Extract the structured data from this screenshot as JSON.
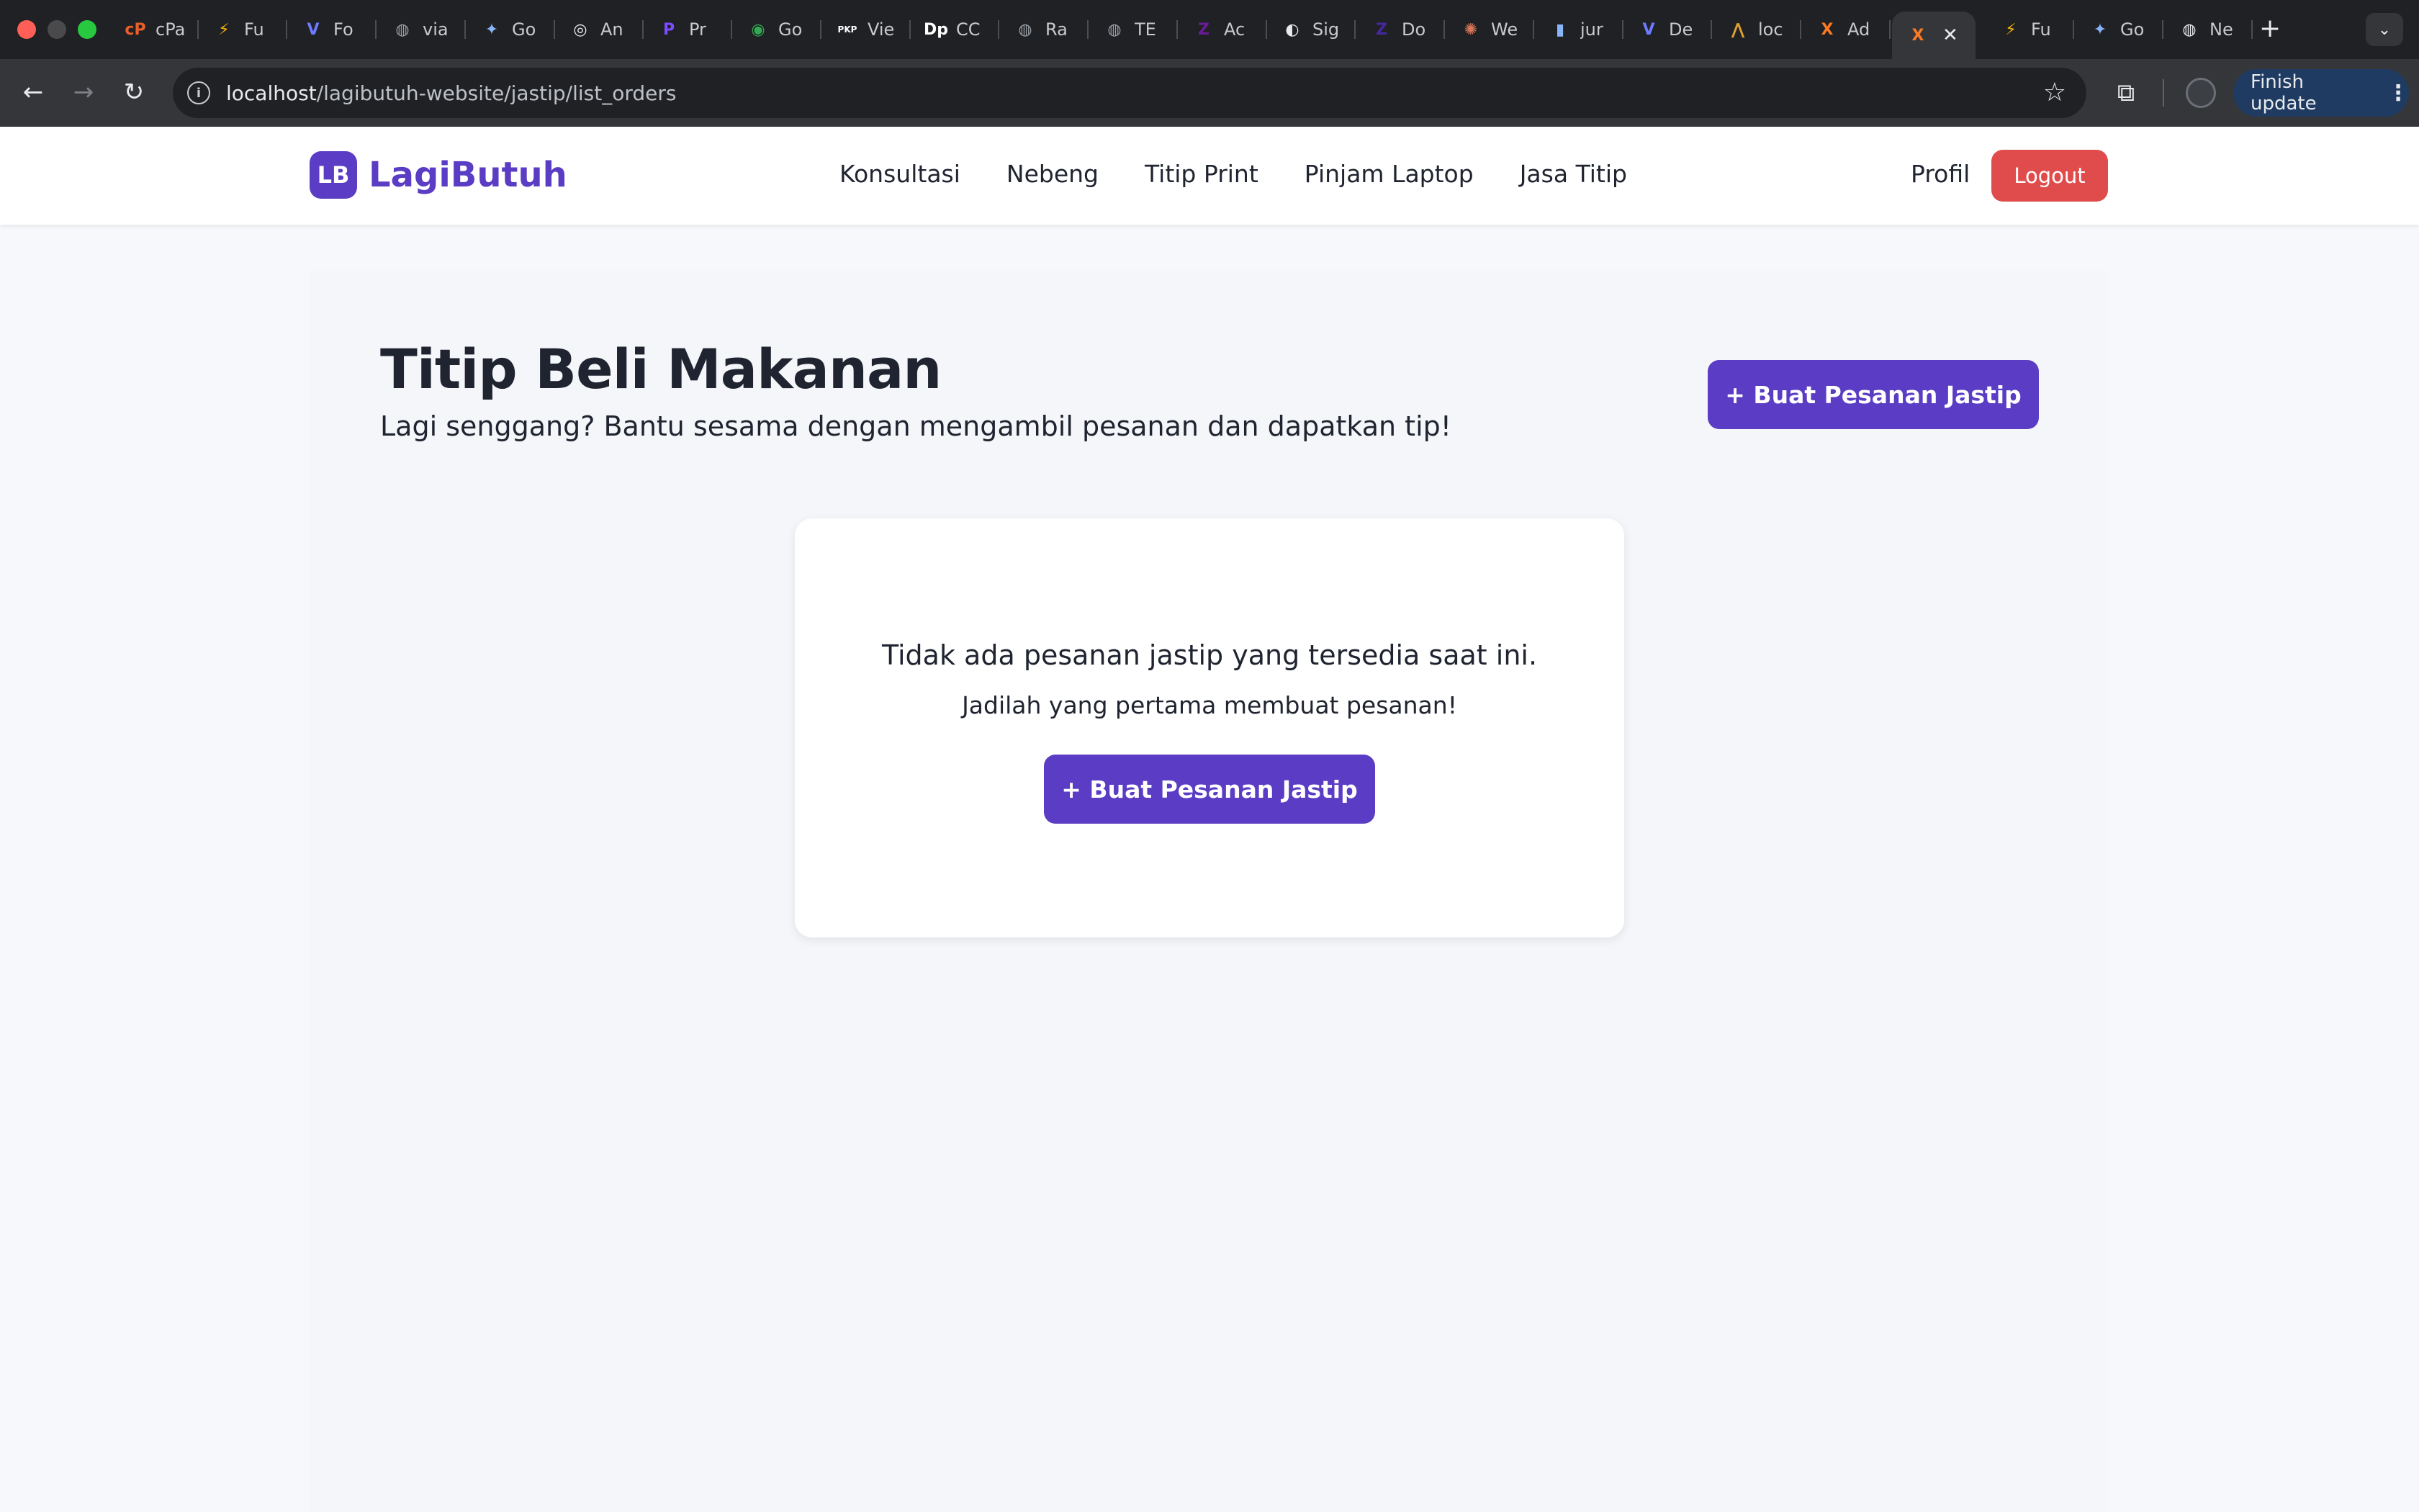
{
  "browser": {
    "tabs": [
      {
        "title": "cPanel",
        "icon": "cpanel-icon",
        "color": "#e8602c",
        "glyph": "cP"
      },
      {
        "title": "Fu",
        "icon": "bolt-icon",
        "color": "#f4b400",
        "glyph": "⚡"
      },
      {
        "title": "Fo",
        "icon": "vercel-icon",
        "color": "#6c7bff",
        "glyph": "V"
      },
      {
        "title": "via",
        "icon": "globe-icon",
        "color": "#9aa0a6",
        "glyph": "◍"
      },
      {
        "title": "Go",
        "icon": "gemini-icon",
        "color": "#8ab4f8",
        "glyph": "✦"
      },
      {
        "title": "An",
        "icon": "openai-icon",
        "color": "#e8eaed",
        "glyph": "◎"
      },
      {
        "title": "Pr",
        "icon": "app-icon",
        "color": "#7c4dff",
        "glyph": "P"
      },
      {
        "title": "Go",
        "icon": "maps-icon",
        "color": "#34a853",
        "glyph": "◉"
      },
      {
        "title": "Vie",
        "icon": "pkp-icon",
        "color": "#ffffff",
        "glyph": "PKP"
      },
      {
        "title": "CC",
        "icon": "dp-icon",
        "color": "#ffffff",
        "glyph": "Dp"
      },
      {
        "title": "Ra",
        "icon": "globe-icon",
        "color": "#9aa0a6",
        "glyph": "◍"
      },
      {
        "title": "TE",
        "icon": "globe-icon",
        "color": "#9aa0a6",
        "glyph": "◍"
      },
      {
        "title": "Ac",
        "icon": "app-icon",
        "color": "#6a1b9a",
        "glyph": "Z"
      },
      {
        "title": "Sig",
        "icon": "github-icon",
        "color": "#e8eaed",
        "glyph": "◐"
      },
      {
        "title": "Do",
        "icon": "app-icon",
        "color": "#4527a0",
        "glyph": "Z"
      },
      {
        "title": "We",
        "icon": "claude-icon",
        "color": "#d97757",
        "glyph": "✺"
      },
      {
        "title": "jur",
        "icon": "doc-icon",
        "color": "#8ab4f8",
        "glyph": "▮"
      },
      {
        "title": "De",
        "icon": "vercel-icon",
        "color": "#6c7bff",
        "glyph": "V"
      },
      {
        "title": "loc",
        "icon": "app-icon",
        "color": "#e0a030",
        "glyph": "⋀"
      },
      {
        "title": "Ad",
        "icon": "xampp-icon",
        "color": "#fb7a24",
        "glyph": "X"
      },
      {
        "title": "",
        "icon": "xampp-icon",
        "color": "#fb7a24",
        "glyph": "X",
        "active": true
      },
      {
        "title": "Fu",
        "icon": "bolt-icon",
        "color": "#f4b400",
        "glyph": "⚡"
      },
      {
        "title": "Go",
        "icon": "gemini-icon",
        "color": "#8ab4f8",
        "glyph": "✦"
      },
      {
        "title": "Ne",
        "icon": "chrome-icon",
        "color": "#e8eaed",
        "glyph": "◍"
      }
    ],
    "url_host": "localhost",
    "url_path": "/lagibutuh-website/jastip/list_orders",
    "finish_update_label": "Finish update"
  },
  "site": {
    "brand_initials": "LB",
    "brand_name": "LagiButuh",
    "nav": [
      "Konsultasi",
      "Nebeng",
      "Titip Print",
      "Pinjam Laptop",
      "Jasa Titip"
    ],
    "profile_label": "Profil",
    "logout_label": "Logout",
    "colors": {
      "brand": "#5b3cc4",
      "logout": "#e04c4c"
    }
  },
  "main": {
    "title": "Titip Beli Makanan",
    "subtitle": "Lagi senggang? Bantu sesama dengan mengambil pesanan dan dapatkan tip!",
    "create_button_label": "+ Buat Pesanan Jastip",
    "empty_state": {
      "message": "Tidak ada pesanan jastip yang tersedia saat ini.",
      "submessage": "Jadilah yang pertama membuat pesanan!",
      "button_label": "+ Buat Pesanan Jastip"
    }
  }
}
